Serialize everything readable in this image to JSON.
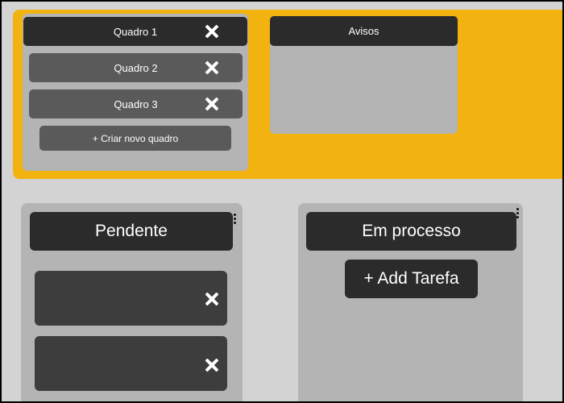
{
  "boards": {
    "items": [
      {
        "label": "Quadro 1",
        "active": true
      },
      {
        "label": "Quadro 2",
        "active": false
      },
      {
        "label": "Quadro 3",
        "active": false
      }
    ],
    "create_label": "+ Criar novo quadro"
  },
  "notices": {
    "title": "Avisos"
  },
  "columns": [
    {
      "title": "Pendente",
      "task_count": 2
    },
    {
      "title": "Em processo",
      "add_task_label": "+ Add Tarefa"
    }
  ],
  "icons": {
    "close": "close-icon",
    "menu": "kebab-menu-icon"
  },
  "colors": {
    "accent": "#f2b311",
    "panel": "#b4b4b4",
    "dark": "#2b2b2b",
    "secondary": "#5a5a5a",
    "card": "#3d3d3d",
    "background": "#d3d3d3"
  }
}
